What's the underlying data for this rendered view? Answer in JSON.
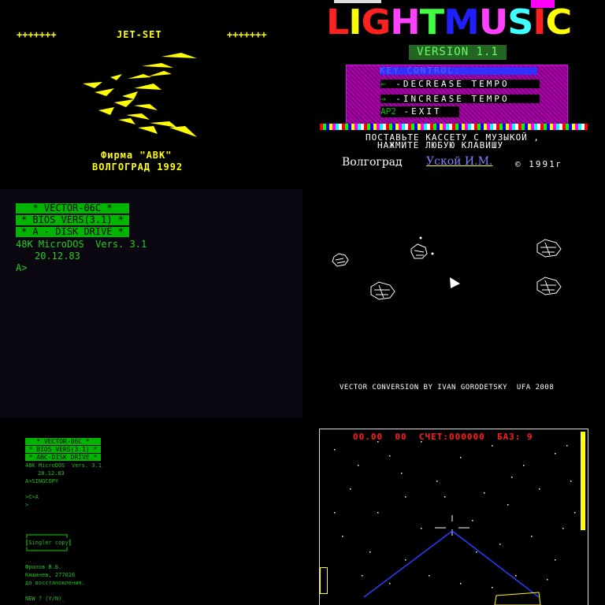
{
  "jetset": {
    "left_marks": "+++++++",
    "title": "JET-SET",
    "right_marks": "+++++++",
    "firm": "Фирма \"АВК\"",
    "city_year": "ВОЛГОГРАД 1992"
  },
  "lightmusic": {
    "title_letters": [
      "L",
      "I",
      "G",
      "H",
      "T",
      "M",
      "U",
      "S",
      "I",
      "C"
    ],
    "title_colors": [
      "#ff2020",
      "#ffff00",
      "#ff2020",
      "#ff40ff",
      "#40ff40",
      "#2020ff",
      "#ff40ff",
      "#40ffff",
      "#ff2020",
      "#ffff00"
    ],
    "version": "VERSION 1.1",
    "key_header": "KEY CONTROL:",
    "decrease_key": "←",
    "decrease": "-DECREASE TEMPO",
    "increase_key": "→",
    "increase": "-INCREASE TEMPO",
    "exit_key": "AP2",
    "exit": "-EXIT",
    "prompt_line1": "ПОСТАВЬТЕ КАССЕТУ С МУЗЫКОЙ ,",
    "prompt_line2": "НАЖМИТЕ ЛЮБУЮ КЛАВИШУ",
    "city": "Волгоград",
    "author": "Уской И.М.",
    "copyright": "© 1991г"
  },
  "bios": {
    "line1": "*   VECTOR-06C   *",
    "line2": "* BIOS VERS(3.1) *",
    "line3": "* A - DISK DRIVE *",
    "os": "48K MicroDOS  Vers. 3.1",
    "date": "20.12.83",
    "prompt": "A>"
  },
  "asteroids": {
    "credit": "VECTOR CONVERSION BY IVAN GORODETSKY  UFA 2008"
  },
  "dos2": {
    "line1": "*   VECTOR-06C   *",
    "line2": "* BIOS VERS(3.1) *",
    "line3": "* ABC-DISK DRIVE *",
    "os": "48K MicroDOS  Vers. 3.1",
    "date": "20.12.83",
    "cmd": "A>SINGCOPY",
    "blank1": "",
    "cmd2": ">C>A",
    "cmd3": ">",
    "box1": "╔═══════════╗",
    "box2": "║Singler copy║",
    "box3": "╚═══════════╝",
    "author1": "Фролов В.Б.",
    "author2": "Кишинев, 277026",
    "author3": "до восстановления.",
    "ask": "NEW ? (Y/N)_"
  },
  "game": {
    "hud": "00.00  00  СЧЕТ:000000  БАЗ: 9"
  },
  "colors": {
    "yellow": "#ffff00",
    "green_box": "#00b400",
    "hud_red": "#ff2020",
    "beam_blue": "#2a3cff"
  }
}
